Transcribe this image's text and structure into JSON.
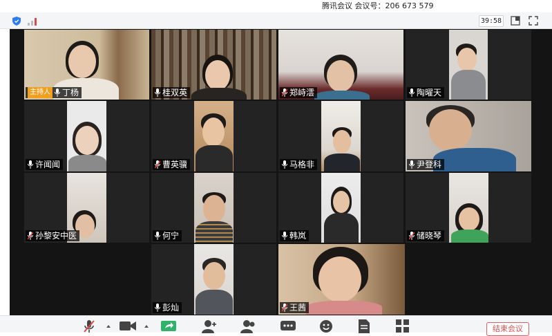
{
  "window": {
    "title": "腾讯会议 会议号：206 673 579"
  },
  "topbar": {
    "timer": "39:58",
    "icons": [
      "shield-icon",
      "signal-icon",
      "layout-icon",
      "fullscreen-icon"
    ]
  },
  "host_label": "主持人",
  "participants": [
    {
      "name": "丁杨",
      "host": true,
      "mic": "on"
    },
    {
      "name": "桂双英",
      "host": false,
      "mic": "on"
    },
    {
      "name": "郑峙澐",
      "host": false,
      "mic": "muted"
    },
    {
      "name": "陶曜天",
      "host": false,
      "mic": "on"
    },
    {
      "name": "许闻闻",
      "host": false,
      "mic": "on"
    },
    {
      "name": "曹英骥",
      "host": false,
      "mic": "muted"
    },
    {
      "name": "马格非",
      "host": false,
      "mic": "on"
    },
    {
      "name": "尹登科",
      "host": false,
      "mic": "on"
    },
    {
      "name": "孙黎安中医",
      "host": false,
      "mic": "muted"
    },
    {
      "name": "何宁",
      "host": false,
      "mic": "on"
    },
    {
      "name": "韩岚",
      "host": false,
      "mic": "on"
    },
    {
      "name": "储晓琴",
      "host": false,
      "mic": "muted"
    },
    {
      "name": "彭灿",
      "host": false,
      "mic": "on"
    },
    {
      "name": "王茜",
      "host": false,
      "mic": "muted"
    }
  ],
  "toolbar": {
    "items": [
      "mic-muted-icon",
      "video-icon",
      "share-screen-icon",
      "invite-icon",
      "members-icon",
      "chat-icon",
      "emoji-icon",
      "document-icon",
      "apps-icon"
    ],
    "end_label": "结束会议"
  },
  "colors": {
    "host_tag": "#f0a020",
    "end_button": "#e05050",
    "share_green": "#2fb36b",
    "mute_red": "#e04848"
  }
}
